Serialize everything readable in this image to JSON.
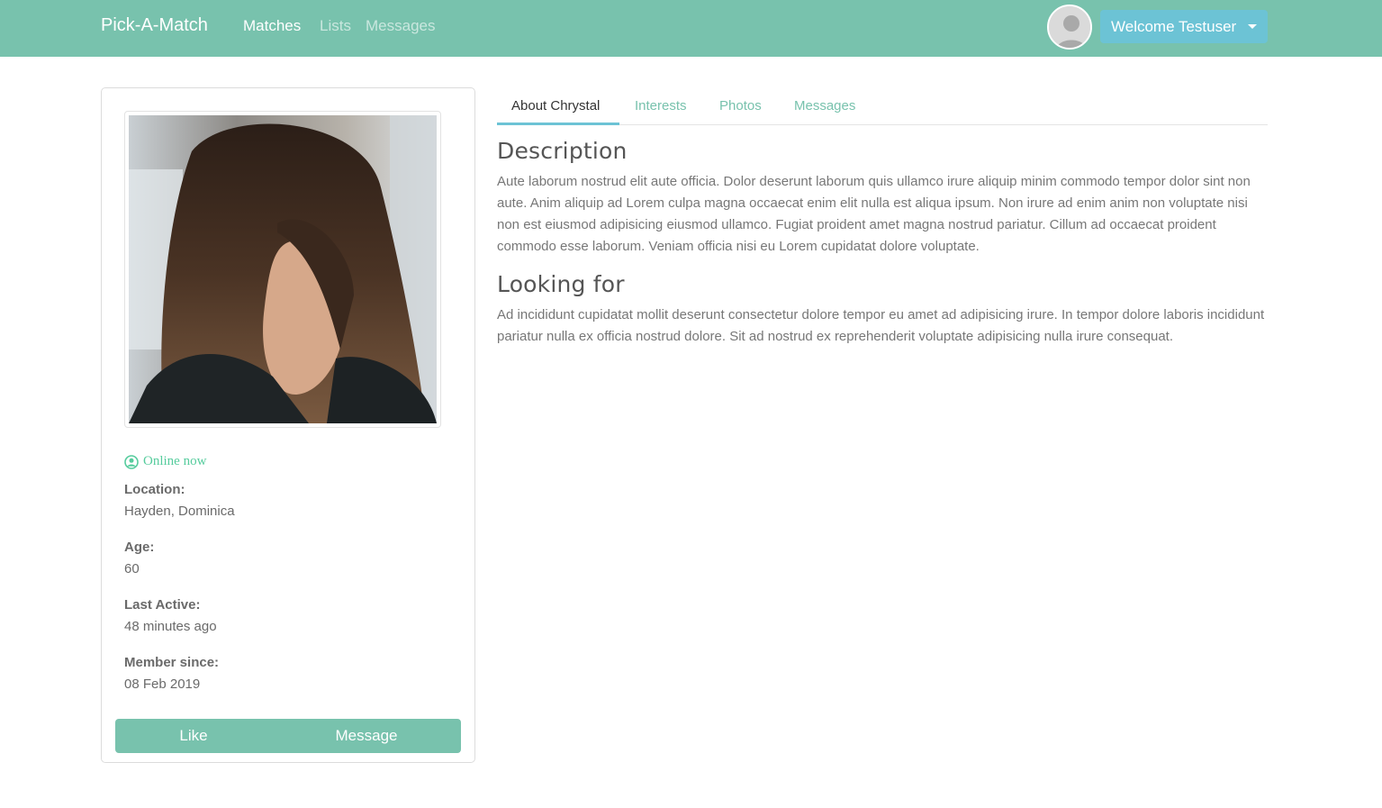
{
  "navbar": {
    "brand": "Pick-A-Match",
    "links": [
      {
        "label": "Matches",
        "active": true
      },
      {
        "label": "Lists",
        "active": false
      },
      {
        "label": "Messages",
        "active": false
      }
    ],
    "welcome": "Welcome Testuser",
    "avatar_icon": "user-avatar-icon"
  },
  "profile": {
    "status": "Online now",
    "status_icon": "user-circle-icon",
    "fields": [
      {
        "label": "Location:",
        "value": "Hayden, Dominica"
      },
      {
        "label": "Age:",
        "value": "60"
      },
      {
        "label": "Last Active:",
        "value": "48 minutes ago"
      },
      {
        "label": "Member since:",
        "value": "08 Feb 2019"
      }
    ],
    "buttons": {
      "like": "Like",
      "message": "Message"
    }
  },
  "tabs": [
    {
      "label": "About Chrystal",
      "active": true
    },
    {
      "label": "Interests",
      "active": false
    },
    {
      "label": "Photos",
      "active": false
    },
    {
      "label": "Messages",
      "active": false
    }
  ],
  "about": {
    "description_title": "Description",
    "description": "Aute laborum nostrud elit aute officia. Dolor deserunt laborum quis ullamco irure aliquip minim commodo tempor dolor sint non aute. Anim aliquip ad Lorem culpa magna occaecat enim elit nulla est aliqua ipsum. Non irure ad enim anim non voluptate nisi non est eiusmod adipisicing eiusmod ullamco. Fugiat proident amet magna nostrud pariatur. Cillum ad occaecat proident commodo esse laborum. Veniam officia nisi eu Lorem cupidatat dolore voluptate.",
    "looking_title": "Looking for",
    "looking": "Ad incididunt cupidatat mollit deserunt consectetur dolore tempor eu amet ad adipisicing irure. In tempor dolore laboris incididunt pariatur nulla ex officia nostrud dolore. Sit ad nostrud ex reprehenderit voluptate adipisicing nulla irure consequat."
  },
  "colors": {
    "primary": "#78c2ad",
    "info": "#6cc3d5",
    "success": "#56cc9d"
  }
}
